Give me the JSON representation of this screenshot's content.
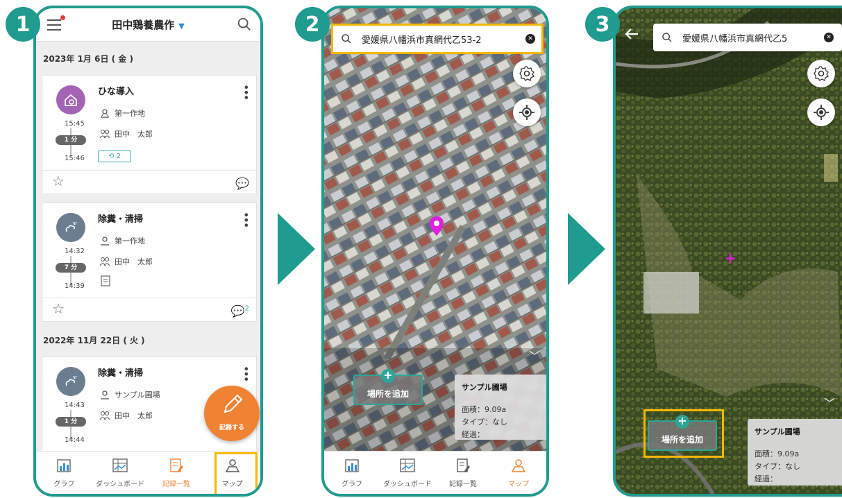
{
  "steps": [
    "1",
    "2",
    "3"
  ],
  "screen1": {
    "farm_name": "田中鶏養農作",
    "sections": [
      {
        "date": "2023年 1月 6日 ( 金 )",
        "cards": [
          {
            "title": "ひな導入",
            "place": "第一作地",
            "person": "田中　太郎",
            "start": "15:45",
            "duration": "1 分",
            "end": "15:46",
            "chip": "2",
            "comments": ""
          },
          {
            "title": "除糞・清掃",
            "place": "第一作地",
            "person": "田中　太郎",
            "start": "14:32",
            "duration": "7 分",
            "end": "14:39",
            "chip": "",
            "comments": "2"
          }
        ]
      },
      {
        "date": "2022年 11月 22日 ( 火 )",
        "cards": [
          {
            "title": "除糞・清掃",
            "place": "サンプル圃場",
            "person": "田中　太郎",
            "start": "14:43",
            "duration": "1 分",
            "end": "14:44",
            "chip": "",
            "comments": ""
          }
        ]
      }
    ],
    "fab_label": "記録する",
    "nav": [
      "グラフ",
      "ダッシュボード",
      "記録一覧",
      "マップ"
    ]
  },
  "screen2": {
    "search_value": "愛媛県八幡浜市真網代乙53-2",
    "add_place_label": "場所を追加",
    "panel": {
      "title": "サンプル圃場",
      "area": "面積：9.09a",
      "type": "タイプ：なし",
      "history": "経過："
    },
    "nav": [
      "グラフ",
      "ダッシュボード",
      "記録一覧",
      "マップ"
    ]
  },
  "screen3": {
    "search_value": "愛媛県八幡浜市真網代乙5",
    "add_place_label": "場所を追加",
    "panel": {
      "title": "サンプル圃場",
      "area": "面積：9.09a",
      "type": "タイプ：なし",
      "history": "経過："
    }
  },
  "colors": {
    "teal": "#1f9b8f",
    "orange": "#f08233",
    "highlight": "#f5b800",
    "pin": "#e020e0"
  }
}
